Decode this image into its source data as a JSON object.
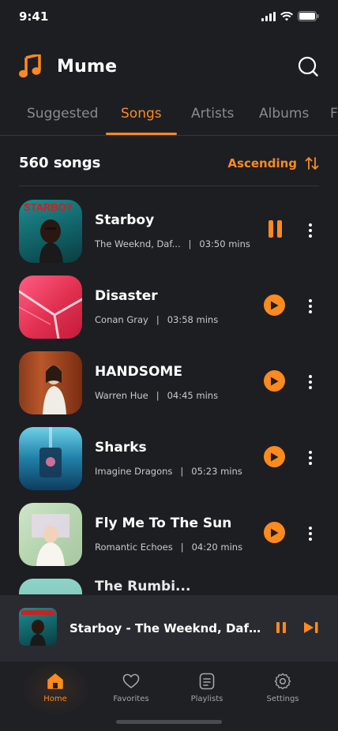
{
  "status_bar": {
    "time": "9:41"
  },
  "app": {
    "title": "Mume"
  },
  "tabs": [
    {
      "label": "Suggested",
      "active": false
    },
    {
      "label": "Songs",
      "active": true
    },
    {
      "label": "Artists",
      "active": false
    },
    {
      "label": "Albums",
      "active": false
    },
    {
      "label": "F",
      "active": false
    }
  ],
  "summary": {
    "count": "560 songs",
    "sort_label": "Ascending"
  },
  "songs": [
    {
      "title": "Starboy",
      "artist": "The Weeknd, Daf...",
      "duration": "03:50 mins",
      "state": "playing",
      "art_label": "STARBOY"
    },
    {
      "title": "Disaster",
      "artist": "Conan Gray",
      "duration": "03:58 mins",
      "state": "paused"
    },
    {
      "title": "HANDSOME",
      "artist": "Warren Hue",
      "duration": "04:45 mins",
      "state": "paused"
    },
    {
      "title": "Sharks",
      "artist": "Imagine Dragons",
      "duration": "05:23 mins",
      "state": "paused"
    },
    {
      "title": "Fly Me To The Sun",
      "artist": "Romantic Echoes",
      "duration": "04:20 mins",
      "state": "paused"
    },
    {
      "title": "The Rumbi...",
      "state": "partial"
    }
  ],
  "mini_player": {
    "title": "Starboy - The Weeknd, Daft Pu..."
  },
  "bottom_nav": [
    {
      "label": "Home",
      "icon": "home-icon",
      "active": true
    },
    {
      "label": "Favorites",
      "icon": "heart-icon",
      "active": false
    },
    {
      "label": "Playlists",
      "icon": "playlist-icon",
      "active": false
    },
    {
      "label": "Settings",
      "icon": "gear-icon",
      "active": false
    }
  ],
  "colors": {
    "accent": "#ff8a1e",
    "background": "#1d1e22",
    "mini_player_bg": "#2a2b30"
  }
}
